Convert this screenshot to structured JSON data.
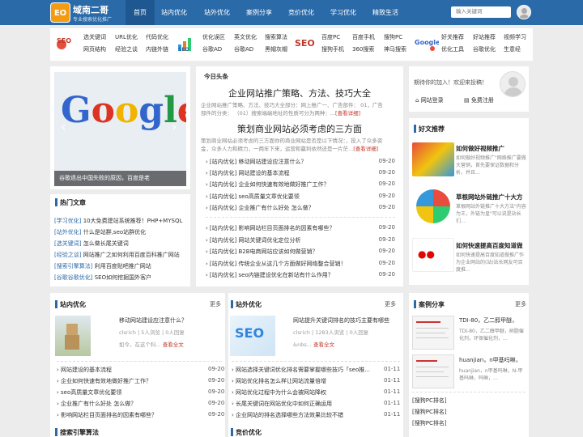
{
  "brand": {
    "badge": "EO",
    "title": "域南二哥",
    "subtitle": "专业搜索优化推广"
  },
  "nav": [
    "首页",
    "站内优化",
    "站外优化",
    "案例分享",
    "竞价优化",
    "学习优化",
    "精致生活"
  ],
  "search": {
    "placeholder": "输入关键词"
  },
  "linkbar": {
    "group1": [
      "选关键词",
      "URL优化",
      "代码优化",
      "网页结构",
      "经验之谈",
      "内链外链"
    ],
    "group2": [
      "优化误区",
      "英文优化",
      "搜索算法",
      "谷歌AD",
      "谷歌AD",
      "黑帽灰帽"
    ],
    "group3": [
      "百度PC",
      "百度手机",
      "搜狗PC",
      "搜狗手机",
      "360搜索",
      "神马搜索"
    ],
    "group4": [
      "好关推荐",
      "好站推荐",
      "视频学习",
      "优化工具",
      "谷歌优化",
      "生意经"
    ],
    "logo_labels": [
      "SEO",
      "SEO",
      "SEO",
      "Google"
    ]
  },
  "slider": {
    "caption": "谷歌退出中国失败的原因，百度是老",
    "logo": [
      "G",
      "o",
      "o",
      "g",
      "l",
      "e"
    ],
    "colors": [
      "#3366cc",
      "#dd3322",
      "#f0b400",
      "#3366cc",
      "#229944",
      "#dd3322"
    ]
  },
  "hot": {
    "title": "热门文章",
    "items": [
      {
        "tag": "[学习优化]",
        "text": "10大免费建站系统推荐！PHP+MYSQL"
      },
      {
        "tag": "[站外优化]",
        "text": "什么是站群,seo站群优化"
      },
      {
        "tag": "[选关键词]",
        "text": "怎么做长尾关键词"
      },
      {
        "tag": "[经验之谈]",
        "text": "网站推广之如何利用百度百科推广网站"
      },
      {
        "tag": "[搜索引擎算法]",
        "text": "利用百度贴吧推广网站"
      },
      {
        "tag": "[谷歌谷歌优化]",
        "text": "SEO如何挖掘国外客户"
      }
    ]
  },
  "headlines": {
    "title": "今日头条",
    "top1": {
      "title": "企业网站推广策略、方法、技巧大全",
      "desc": "企业网站推广策略、方法、技巧大全部分：网上推广一、广告部件： 01，广告部件的分类： （01）搜索端端地址的性质可分为两种：...",
      "more": "[查看详细]"
    },
    "top2": {
      "title": "策划商业网站必须考虑的三方面",
      "desc": "策划商业网站必须考虑的三方面你的商业网站是否是以下情况：，投入了众多资金，众多人力和精力，一两年下来，运营和赢利依然还是一片茫...",
      "more": "[查看详细]"
    },
    "list1": [
      {
        "t": "[站内优化] 移动网站建设应注意什么？",
        "d": "09-20"
      },
      {
        "t": "[站内优化] 网站建设的基本流程",
        "d": "09-20"
      },
      {
        "t": "[站内优化] 企业如何快速有效地做好推广工作？",
        "d": "09-20"
      },
      {
        "t": "[站内优化] seo高质量文章优化要领",
        "d": "09-20"
      },
      {
        "t": "[站内优化] 企业推广有什么好处 怎么做？",
        "d": "09-20"
      }
    ],
    "list2": [
      {
        "t": "[站内优化] 影响网站栏目页面排名的因素有哪些？",
        "d": "09-20"
      },
      {
        "t": "[站内优化] 网站关键词优化定位分析",
        "d": "09-20"
      },
      {
        "t": "[站内优化] B2B电商网站应该如何做营销？",
        "d": "09-20"
      },
      {
        "t": "[站内优化] 传统企业从这几个方面做好网络整合营销！",
        "d": "09-20"
      },
      {
        "t": "[站内优化] seo内链建设优化在新站有什么作用？",
        "d": "09-20"
      }
    ]
  },
  "login": {
    "welcome": "期待你的加入！欢迎来投稿！",
    "login": "网站登录",
    "register": "免费注册"
  },
  "friends": {
    "title": "好文推荐",
    "items": [
      {
        "title": "如何做好视频推广",
        "desc": "如何做好视频推广\"网络推广要做大营销，首先要保证数据和分析，并且..."
      },
      {
        "title": "草根网站外链推广十大方",
        "desc": "草根网站外链推广十大方法\"内容为王，外链为皇\"可以说是站长们..."
      },
      {
        "title": "如何快速提高百度知道做",
        "desc": "如何快速提高百度知道做推广作为企业网站的(站)站长网友可百度推..."
      }
    ]
  },
  "bottom": {
    "more": "更多",
    "zn": {
      "title": "站内优化",
      "ft": "移动网站建设应注意什么？",
      "meta": "clsrich | 5人浏览 | 0人回复",
      "desc": "如今，在这个科...",
      "rm": "查看全文",
      "list": [
        {
          "t": "网站建设的基本流程",
          "d": "09-20"
        },
        {
          "t": "企业如何快速有效地做好推广工作？",
          "d": "09-20"
        },
        {
          "t": "seo高质量文章优化要领",
          "d": "09-20"
        },
        {
          "t": "企业推广有什么好处 怎么做？",
          "d": "09-20"
        },
        {
          "t": "影响网站栏目页面排名的因素有哪些？",
          "d": "09-20"
        }
      ]
    },
    "zw": {
      "title": "站外优化",
      "ft": "网站提升关键词排名的技巧主要有哪些",
      "meta": "clsrich | 1283人浏览 | 0人回复",
      "desc": "&nbs...",
      "rm": "查看全文",
      "list": [
        {
          "t": "网站选择关键词优化排名需要掌握哪些技巧「seo推...",
          "d": "01-11"
        },
        {
          "t": "网站优化排名怎么样让网站流量倍增",
          "d": "01-11"
        },
        {
          "t": "网站优化过程中为什么会被网站降权",
          "d": "01-11"
        },
        {
          "t": "长尾关键词在网站优化中如何正确运用",
          "d": "01-11"
        },
        {
          "t": "企业网站的排名选择哪些方法效果比较不错",
          "d": "01-11"
        }
      ]
    },
    "case": {
      "title": "案例分享",
      "i1t": "TDI-80，乙二醇甲醚，",
      "i1d": "TDI-80，乙二醇甲醚，树脂催化剂，环保催化剂，...",
      "i2t": "huanjian，n甲基吗啉，",
      "i2d": "huanjian，n甲基吗啉，N-甲基吗啉，吗啉，...",
      "list": [
        "[搜狗PC排名]",
        "[搜狗PC排名]",
        "[搜狗PC排名]"
      ]
    },
    "ss": "搜索引擎算法",
    "jj": "竞价优化"
  }
}
